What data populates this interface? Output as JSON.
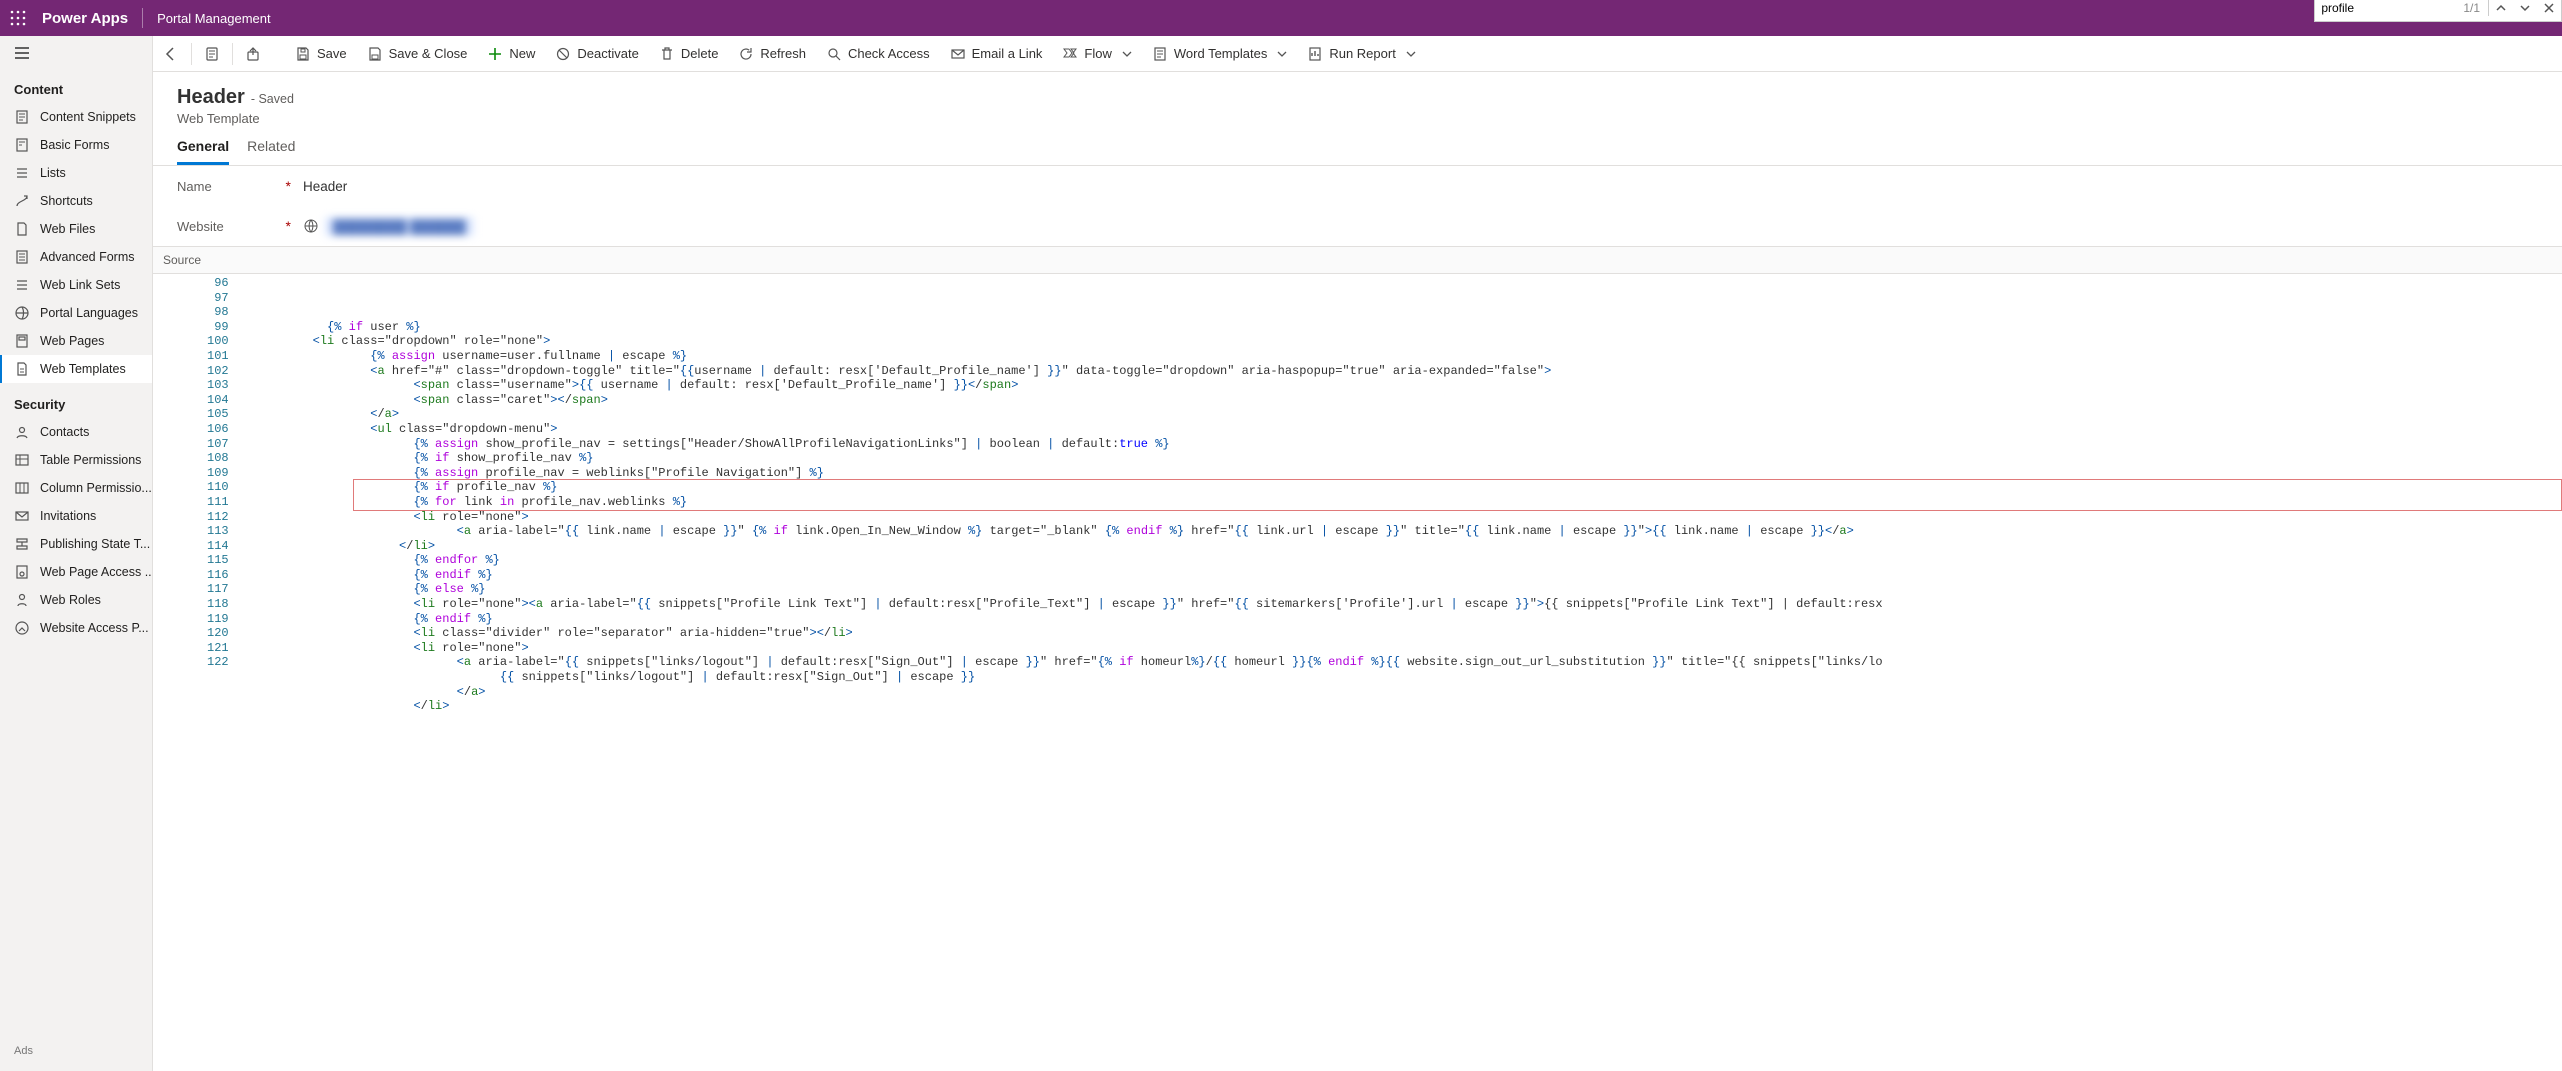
{
  "app": {
    "name": "Power Apps",
    "area": "Portal Management"
  },
  "findbar": {
    "value": "profile",
    "count": "1/1"
  },
  "nav": {
    "group1": {
      "title": "Content",
      "items": [
        {
          "icon": "snippet",
          "label": "Content Snippets"
        },
        {
          "icon": "form",
          "label": "Basic Forms"
        },
        {
          "icon": "list",
          "label": "Lists"
        },
        {
          "icon": "shortcut",
          "label": "Shortcuts"
        },
        {
          "icon": "file",
          "label": "Web Files"
        },
        {
          "icon": "advform",
          "label": "Advanced Forms"
        },
        {
          "icon": "linkset",
          "label": "Web Link Sets"
        },
        {
          "icon": "lang",
          "label": "Portal Languages"
        },
        {
          "icon": "page",
          "label": "Web Pages"
        },
        {
          "icon": "template",
          "label": "Web Templates",
          "active": true
        }
      ]
    },
    "group2": {
      "title": "Security",
      "items": [
        {
          "icon": "contact",
          "label": "Contacts"
        },
        {
          "icon": "tableperm",
          "label": "Table Permissions"
        },
        {
          "icon": "colperm",
          "label": "Column Permissio..."
        },
        {
          "icon": "invite",
          "label": "Invitations"
        },
        {
          "icon": "pubstate",
          "label": "Publishing State T..."
        },
        {
          "icon": "pageaccess",
          "label": "Web Page Access ..."
        },
        {
          "icon": "role",
          "label": "Web Roles"
        },
        {
          "icon": "siteaccess",
          "label": "Website Access P..."
        }
      ]
    },
    "ads": "Ads"
  },
  "commands": {
    "save": "Save",
    "saveclose": "Save & Close",
    "new": "New",
    "deactivate": "Deactivate",
    "delete": "Delete",
    "refresh": "Refresh",
    "checkaccess": "Check Access",
    "emaillink": "Email a Link",
    "flow": "Flow",
    "wordtemplates": "Word Templates",
    "runreport": "Run Report"
  },
  "record": {
    "title": "Header",
    "state": "- Saved",
    "entity": "Web Template",
    "tabs": {
      "general": "General",
      "related": "Related"
    },
    "fields": {
      "name": {
        "label": "Name",
        "value": "Header"
      },
      "website": {
        "label": "Website",
        "value": "████████ ██████"
      },
      "sourceLabel": "Source"
    }
  },
  "code": {
    "start": 96,
    "highlight": 110,
    "lines": [
      "{% if user %}",
      "<li class=\"dropdown\" role=\"none\">",
      "    {% assign username=user.fullname | escape %}",
      "    <a href=\"#\" class=\"dropdown-toggle\" title=\"{{username | default: resx['Default_Profile_name'] }}\" data-toggle=\"dropdown\" aria-haspopup=\"true\" aria-expanded=\"false\">",
      "        <span class=\"username\">{{ username | default: resx['Default_Profile_name'] }}</span>",
      "        <span class=\"caret\"></span>",
      "    </a>",
      "    <ul class=\"dropdown-menu\">",
      "        {% assign show_profile_nav = settings[\"Header/ShowAllProfileNavigationLinks\"] | boolean | default:true %}",
      "        {% if show_profile_nav %}",
      "        {% assign profile_nav = weblinks[\"Profile Navigation\"] %}",
      "        {% if profile_nav %}",
      "        {% for link in profile_nav.weblinks %}",
      "        <li role=\"none\">",
      "            <a aria-label=\"{{ link.name | escape }}\" {% if link.Open_In_New_Window %} target=\"_blank\" {% endif %} href=\"{{ link.url | escape }}\" title=\"{{ link.name | escape }}\">{{ link.name | escape }}</a>",
      "        </li>",
      "        {% endfor %}",
      "        {% endif %}",
      "        {% else %}",
      "        <li role=\"none\"><a aria-label=\"{{ snippets[\"Profile Link Text\"] | default:resx[\"Profile_Text\"] | escape }}\" href=\"{{ sitemarkers['Profile'].url | escape }}\">{{ snippets[\"Profile Link Text\"] | default:resx",
      "        {% endif %}",
      "        <li class=\"divider\" role=\"separator\" aria-hidden=\"true\"></li>",
      "        <li role=\"none\">",
      "            <a aria-label=\"{{ snippets[\"links/logout\"] | default:resx[\"Sign_Out\"] | escape }}\" href=\"{% if homeurl%}/{{ homeurl }}{% endif %}{{ website.sign_out_url_substitution }}\" title=\"{{ snippets[\"links/lo",
      "                {{ snippets[\"links/logout\"] | default:resx[\"Sign_Out\"] | escape }}",
      "            </a>",
      "        </li>"
    ],
    "indents": [
      12,
      10,
      14,
      14,
      16,
      16,
      14,
      14,
      16,
      16,
      16,
      16,
      16,
      16,
      18,
      14,
      16,
      16,
      16,
      16,
      16,
      16,
      16,
      18,
      20,
      18,
      16
    ]
  }
}
